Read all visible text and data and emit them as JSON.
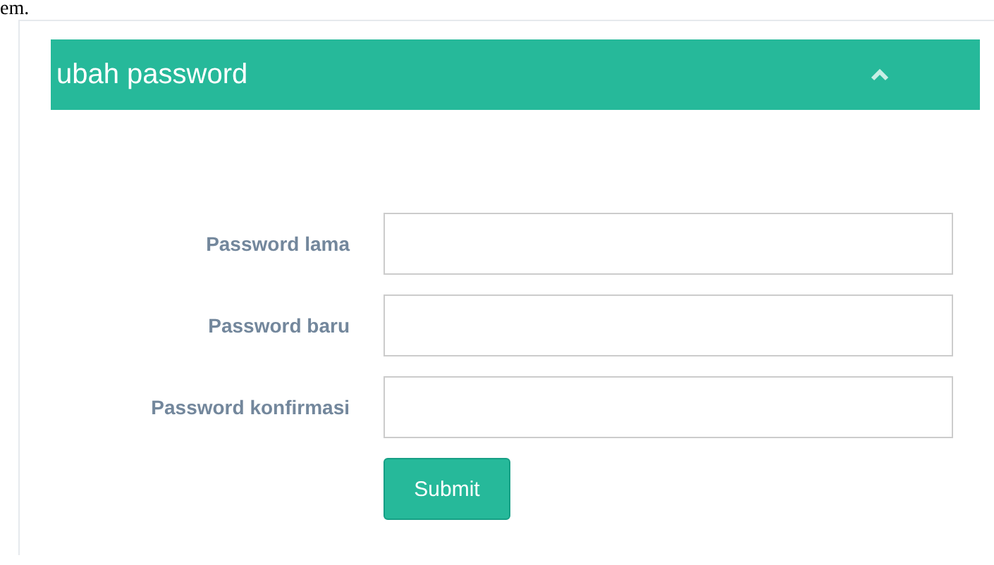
{
  "top_text": "em.",
  "panel": {
    "title": "ubah password",
    "expanded": true
  },
  "fields": [
    {
      "label": "Password lama"
    },
    {
      "label": "Password baru"
    },
    {
      "label": "Password konfirmasi"
    }
  ],
  "submit": "Submit"
}
